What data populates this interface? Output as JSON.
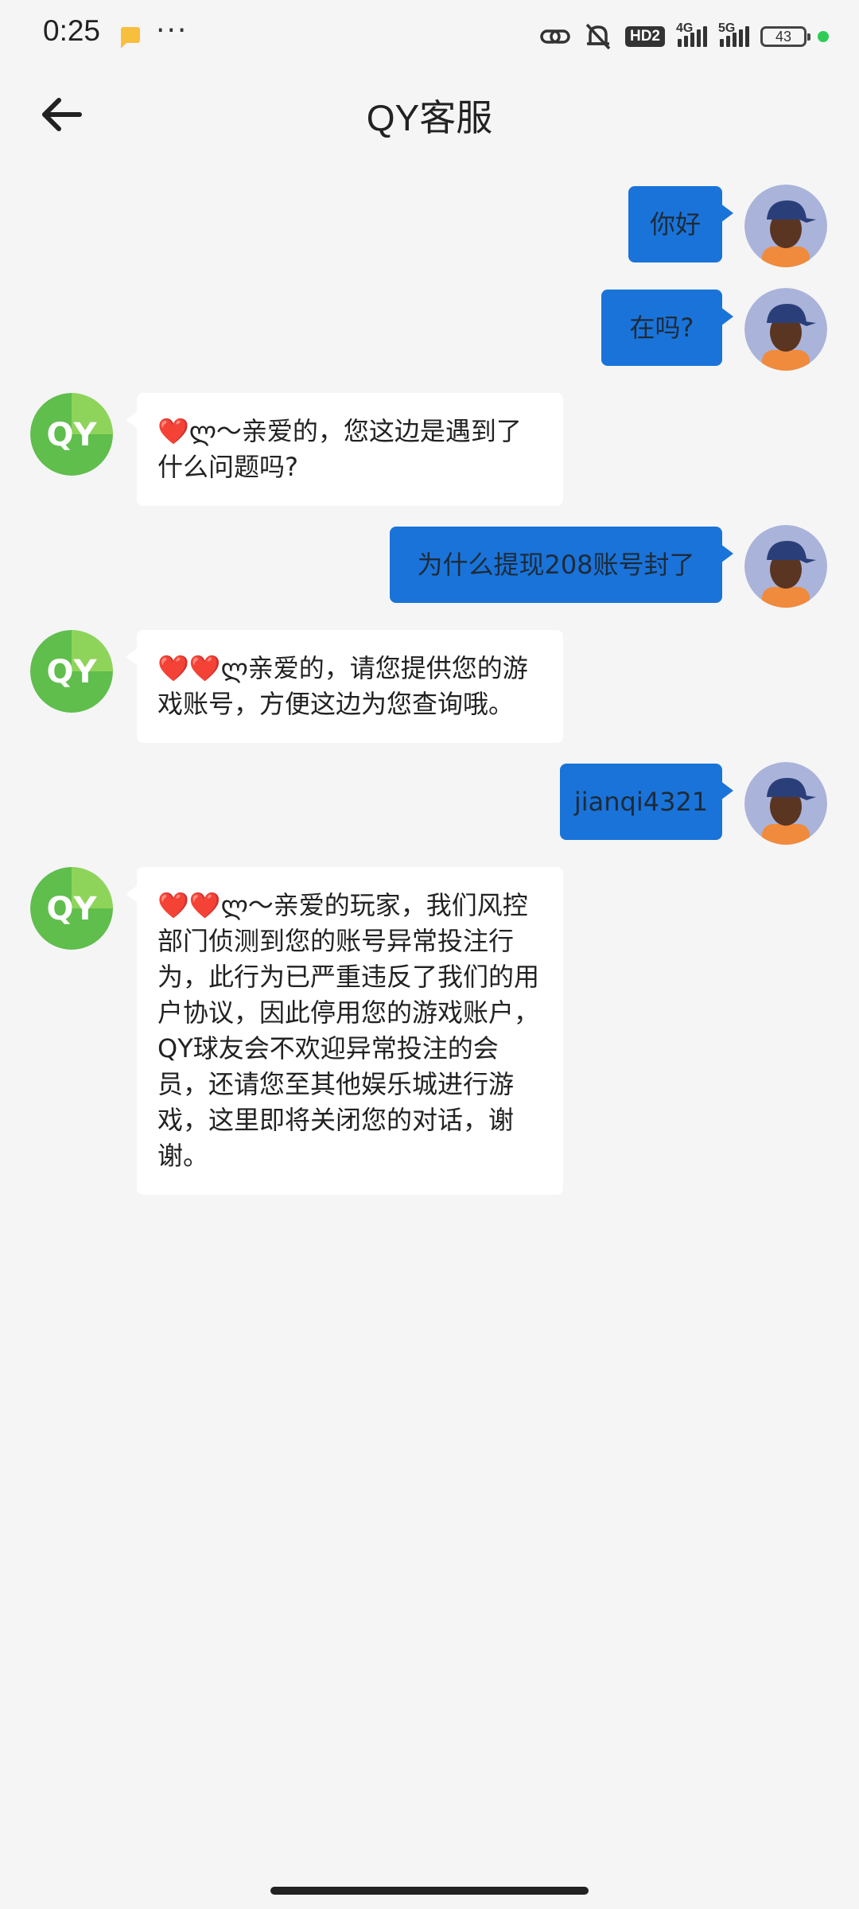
{
  "status_bar": {
    "time": "0:25",
    "hd_label": "HD2",
    "net1_label": "4G",
    "net2_label": "5G",
    "battery": "43"
  },
  "header": {
    "title": "QY客服"
  },
  "messages": [
    {
      "from": "user",
      "text": "你好"
    },
    {
      "from": "user",
      "text": "在吗?"
    },
    {
      "from": "agent",
      "hearts": "❤️",
      "text": "ლ～亲爱的，您这边是遇到了什么问题吗?"
    },
    {
      "from": "user",
      "text": "为什么提现208账号封了"
    },
    {
      "from": "agent",
      "hearts": "❤️❤️",
      "text": "ლ亲爱的，请您提供您的游戏账号，方便这边为您查询哦。"
    },
    {
      "from": "user",
      "text": "jianqi4321"
    },
    {
      "from": "agent",
      "hearts": "❤️❤️",
      "text": "ლ～亲爱的玩家，我们风控部门侦测到您的账号异常投注行为，此行为已严重违反了我们的用户协议，因此停用您的游戏账户，QY球友会不欢迎异常投注的会员，还请您至其他娱乐城进行游戏，这里即将关闭您的对话，谢谢。"
    }
  ],
  "agent_logo_text": "QY",
  "colors": {
    "user_bubble": "#1a73d8",
    "agent_bubble": "#ffffff",
    "background": "#f5f5f6",
    "agent_logo": "#5fbe4c"
  }
}
